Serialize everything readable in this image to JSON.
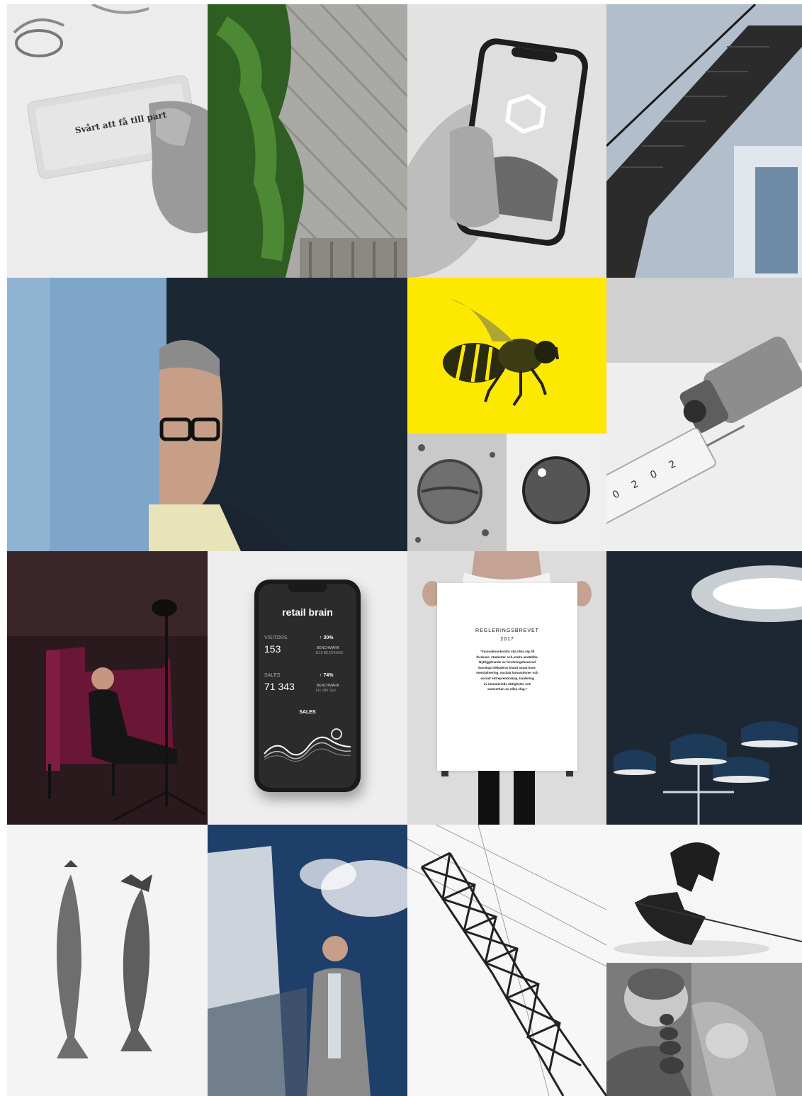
{
  "card": {
    "text": "Svårt att få till part"
  },
  "phone_app": {
    "title": "retail brain",
    "visitors_label": "VISITORS",
    "visitors_value": "153",
    "visitors_change": "↑ 30%",
    "visitors_bench": "BENCHMARK",
    "visitors_bench_sub": "1118 BESÖKARE",
    "sales_label": "SALES",
    "sales_value": "71 343",
    "sales_change": "↑ 74%",
    "sales_bench": "BENCHMARK",
    "sales_bench_sub": "141 088 SEK",
    "chart_title": "SALES"
  },
  "poster": {
    "title": "REGLERINGSBREVET",
    "year": "2017",
    "lines": [
      "\"Innovationskontor ska rikta sig till",
      "forskare, studenter och andra anställda.",
      "Nyttiggörande av forskningsbaserad",
      "kunskap inkluderar bland annat kom-",
      "mersialisering, sociala innovationer och",
      "socialt entreprenörskap, hantering",
      "av immateriella rättigheter och",
      "samverkan av olika slag.\""
    ]
  },
  "colors": {
    "bee_bg": "#fde800",
    "dark_wall": "#1b2733",
    "maroon_chair": "#6a1636",
    "blue_lamp": "#1d3a58"
  }
}
